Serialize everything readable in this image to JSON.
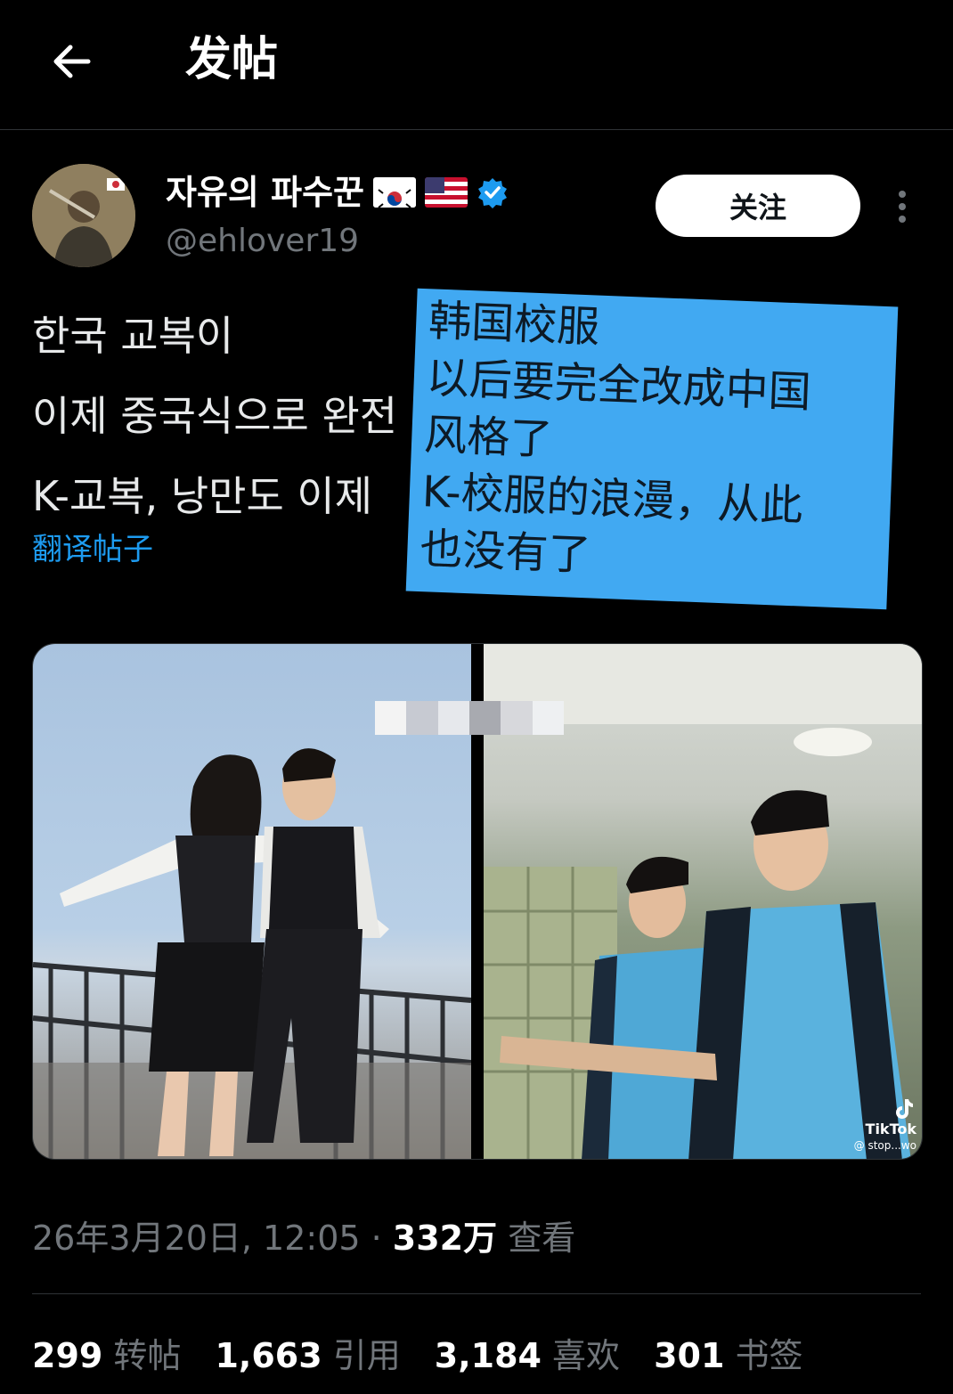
{
  "header": {
    "title": "发帖",
    "back_icon": "arrow-left-icon"
  },
  "author": {
    "display_name": "자유의 파수꾼",
    "flags": [
      "kr-flag",
      "us-flag"
    ],
    "verified_icon": "verified-badge-icon",
    "handle": "@ehlover19",
    "follow_label": "关注",
    "more_icon": "more-vertical-icon"
  },
  "post": {
    "lines": [
      "한국 교복이",
      "이제 중국식으로 완전",
      "K-교복, 낭만도 이제"
    ],
    "translate_label": "翻译帖子"
  },
  "overlay": {
    "lines": [
      "韩国校服",
      "以后要完全改成中国",
      "风格了",
      "K-校服的浪漫，从此",
      "也没有了"
    ]
  },
  "media": {
    "watermark": "TikTok",
    "watermark_sub": "@ stop...wo"
  },
  "meta": {
    "date": "26年3月20日, 12:05 · ",
    "views_count": "332万",
    "views_label": " 查看"
  },
  "stats": {
    "reposts_count": "299",
    "reposts_label": "转帖",
    "quotes_count": "1,663",
    "quotes_label": "引用",
    "likes_count": "3,184",
    "likes_label": "喜欢",
    "bookmarks_count": "301",
    "bookmarks_label": "书签"
  },
  "colors": {
    "background": "#000000",
    "accent": "#1d9bf0",
    "muted": "#71767b",
    "overlay": "#41a9f2"
  }
}
